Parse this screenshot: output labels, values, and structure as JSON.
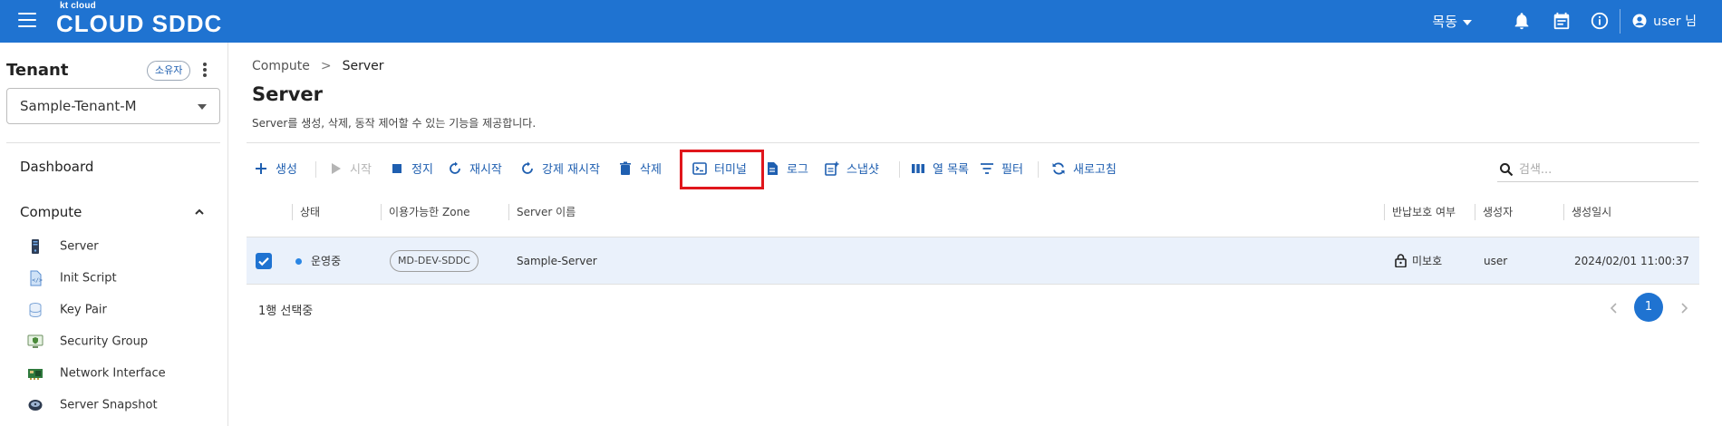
{
  "header": {
    "logo_small": "kt cloud",
    "logo_big": "CLOUD SDDC",
    "region": "목동",
    "user_label": "user 님",
    "brand_color": "#1f73d1",
    "icons": [
      "menu-icon",
      "bell-icon",
      "calendar-icon",
      "info-icon",
      "account-icon"
    ]
  },
  "sidebar": {
    "tenant_title": "Tenant",
    "owner_badge": "소유자",
    "tenant_select": "Sample-Tenant-M",
    "dashboard": "Dashboard",
    "compute": "Compute",
    "items": [
      {
        "label": "Server",
        "icon": "server-icon"
      },
      {
        "label": "Init Script",
        "icon": "script-icon"
      },
      {
        "label": "Key Pair",
        "icon": "key-pair-icon"
      },
      {
        "label": "Security Group",
        "icon": "security-group-icon"
      },
      {
        "label": "Network Interface",
        "icon": "network-interface-icon"
      },
      {
        "label": "Server Snapshot",
        "icon": "snapshot-icon"
      }
    ]
  },
  "breadcrumb": {
    "parent": "Compute",
    "separator": ">",
    "current": "Server"
  },
  "page": {
    "title": "Server",
    "description": "Server를 생성, 삭제, 동작 제어할 수 있는 기능을 제공합니다."
  },
  "toolbar": {
    "create": "생성",
    "start": "시작",
    "stop": "정지",
    "restart": "재시작",
    "force_restart": "강제 재시작",
    "delete": "삭제",
    "terminal": "터미널",
    "log": "로그",
    "snapshot": "스냅샷",
    "columns": "열 목록",
    "filter": "필터",
    "refresh": "새로고침",
    "search_placeholder": "검색..."
  },
  "table": {
    "columns": [
      "상태",
      "이용가능한 Zone",
      "Server 이름",
      "반납보호 여부",
      "생성자",
      "생성일시"
    ],
    "rows": [
      {
        "selected": true,
        "status": "운영중",
        "zone": "MD-DEV-SDDC",
        "name": "Sample-Server",
        "protection": "미보호",
        "creator": "user",
        "created_at": "2024/02/01 11:00:37"
      }
    ]
  },
  "footer": {
    "selected_count": "1행 선택중",
    "current_page": "1"
  }
}
